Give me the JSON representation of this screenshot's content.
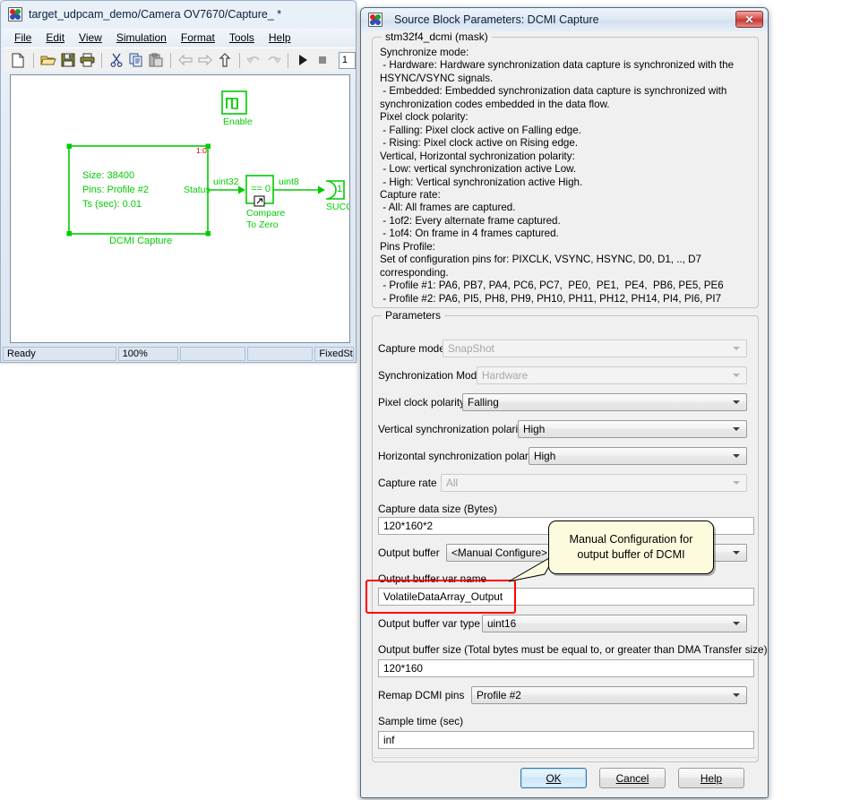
{
  "simulink": {
    "title": "target_udpcam_demo/Camera OV7670/Capture_ *",
    "app_icon": "matlab-simulink-icon",
    "menus": [
      {
        "label": "File"
      },
      {
        "label": "Edit"
      },
      {
        "label": "View"
      },
      {
        "label": "Simulation"
      },
      {
        "label": "Format"
      },
      {
        "label": "Tools"
      },
      {
        "label": "Help"
      }
    ],
    "toolbar": [
      {
        "name": "new-model-icon"
      },
      {
        "name": "open-model-icon"
      },
      {
        "name": "save-icon"
      },
      {
        "name": "print-icon"
      },
      {
        "name": "cut-icon"
      },
      {
        "name": "copy-icon"
      },
      {
        "name": "paste-icon"
      },
      {
        "name": "back-arrow-icon"
      },
      {
        "name": "forward-arrow-icon"
      },
      {
        "name": "up-level-icon"
      },
      {
        "name": "undo-icon"
      },
      {
        "name": "redo-icon"
      },
      {
        "name": "start-simulation-icon"
      },
      {
        "name": "stop-simulation-icon"
      }
    ],
    "sim_time_value": "1",
    "diagram": {
      "enable_block_label": "Enable",
      "dcmi_block": {
        "line1": "Size: 38400",
        "line2": "Pins: Profile #2",
        "line3": "Ts (sec): 0.01",
        "port_label": "Status",
        "corner_label": "1:0",
        "caption": "DCMI Capture"
      },
      "signal_label_1": "uint32",
      "signal_label_2": "uint8",
      "compare_block": {
        "expr": "== 0",
        "caption_line1": "Compare",
        "caption_line2": "To Zero"
      },
      "outport": {
        "number": "1",
        "caption": "SUCCE"
      }
    },
    "statusbar": {
      "status": "Ready",
      "zoom": "100%",
      "cell3": "",
      "cell4": "",
      "solver": "FixedSte"
    }
  },
  "dialog": {
    "title": "Source Block Parameters: DCMI Capture",
    "close_label": "✕",
    "description_legend": "stm32f4_dcmi (mask)",
    "description_text": "Synchronize mode:\n - Hardware: Hardware synchronization data capture is synchronized with the\nHSYNC/VSYNC signals.\n - Embedded: Embedded synchronization data capture is synchronized with\nsynchronization codes embedded in the data flow.\nPixel clock polarity:\n - Falling: Pixel clock active on Falling edge.\n - Rising: Pixel clock active on Rising edge.\nVertical, Horizontal sychronization polarity:\n - Low: vertical synchronization active Low.\n - High: Vertical synchronization active High.\nCapture rate:\n - All: All frames are captured.\n - 1of2: Every alternate frame captured.\n - 1of4: On frame in 4 frames captured.\nPins Profile:\nSet of configuration pins for: PIXCLK, VSYNC, HSYNC, D0, D1, .., D7 corresponding.\n - Profile #1: PA6, PB7, PA4, PC6, PC7,  PE0,  PE1,  PE4,  PB6, PE5, PE6\n - Profile #2: PA6, PI5, PH8, PH9, PH10, PH11, PH12, PH14, PI4, PI6, PI7",
    "parameters_legend": "Parameters",
    "fields": {
      "capture_mode": {
        "label": "Capture mode",
        "value": "SnapShot",
        "disabled": true
      },
      "sync_mode": {
        "label": "Synchronization Mode",
        "value": "Hardware",
        "disabled": true
      },
      "pixel_clock_polarity": {
        "label": "Pixel clock polarity",
        "value": "Falling",
        "disabled": false
      },
      "vsync_polarity": {
        "label": "Vertical synchronization polarity",
        "value": "High",
        "disabled": false
      },
      "hsync_polarity": {
        "label": "Horizontal synchronization polarity",
        "value": "High",
        "disabled": false
      },
      "capture_rate": {
        "label": "Capture rate",
        "value": "All",
        "disabled": true
      },
      "capture_data_size": {
        "label": "Capture data size (Bytes)",
        "value": "120*160*2"
      },
      "output_buffer": {
        "label": "Output buffer",
        "value": "<Manual Configure>",
        "disabled": false
      },
      "output_buffer_var_name": {
        "label": "Output buffer var name",
        "value": "VolatileDataArray_Output"
      },
      "output_buffer_var_type": {
        "label": "Output buffer var type",
        "value": "uint16",
        "disabled": false
      },
      "output_buffer_size": {
        "label": "Output buffer size (Total bytes must be equal to, or greater than DMA Transfer size)",
        "value": "120*160"
      },
      "remap_dcmi_pins": {
        "label": "Remap DCMI pins",
        "value": "Profile #2",
        "disabled": false
      },
      "sample_time": {
        "label": "Sample time (sec)",
        "value": "inf"
      }
    },
    "tooltip": {
      "line1": "Manual Configuration for",
      "line2": "output buffer of DCMI"
    },
    "buttons": {
      "ok": "OK",
      "cancel": "Cancel",
      "help": "Help"
    }
  },
  "colors": {
    "simulink_block_green": "#00cc00",
    "highlight_red": "#ff0000",
    "tooltip_bg": "#fdfbdd",
    "dialog_bg": "#f0f0f0"
  }
}
